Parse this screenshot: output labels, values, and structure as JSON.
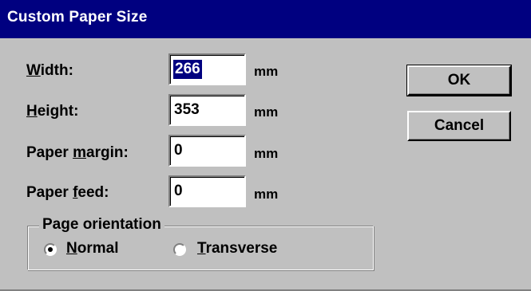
{
  "window": {
    "title": "Custom Paper Size"
  },
  "fields": [
    {
      "label_pre": "",
      "label_accel": "W",
      "label_post": "idth:",
      "value": "266",
      "unit": "mm"
    },
    {
      "label_pre": "",
      "label_accel": "H",
      "label_post": "eight:",
      "value": "353",
      "unit": "mm"
    },
    {
      "label_pre": "Paper ",
      "label_accel": "m",
      "label_post": "argin:",
      "value": "0",
      "unit": "mm"
    },
    {
      "label_pre": "Paper ",
      "label_accel": "f",
      "label_post": "eed:",
      "value": "0",
      "unit": "mm"
    }
  ],
  "buttons": {
    "ok": "OK",
    "cancel": "Cancel"
  },
  "orientation": {
    "legend": "Page orientation",
    "options": [
      {
        "accel": "N",
        "rest": "ormal",
        "selected": true
      },
      {
        "accel": "T",
        "rest": "ransverse",
        "selected": false
      }
    ]
  }
}
